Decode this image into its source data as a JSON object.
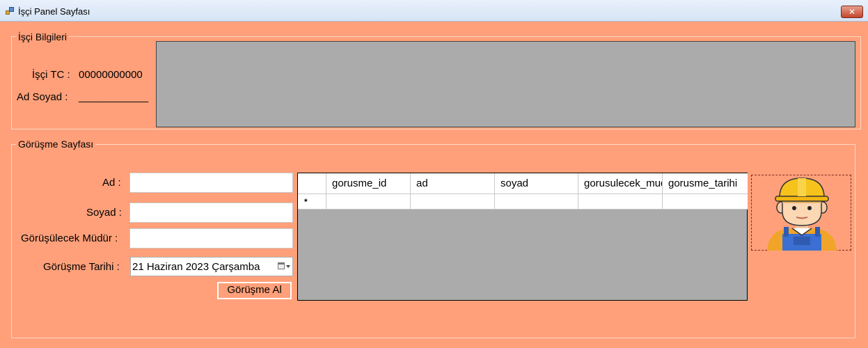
{
  "window": {
    "title": "İşçi Panel Sayfası",
    "close_glyph": "✕"
  },
  "worker_info": {
    "group_label": "İşçi Bilgileri",
    "tc_label": "İşçi TC :",
    "tc_value": "00000000000",
    "name_label": "Ad Soyad :",
    "name_value": "____________"
  },
  "meeting": {
    "group_label": "Görüşme Sayfası",
    "ad_label": "Ad :",
    "soyad_label": "Soyad :",
    "mudur_label": "Görüşülecek Müdür :",
    "tarih_label": "Görüşme Tarihi :",
    "ad_value": "",
    "soyad_value": "",
    "mudur_value": "",
    "date_value": "21  Haziran  2023 Çarşamba",
    "submit_label": "Görüşme Al"
  },
  "grid": {
    "columns": [
      "gorusme_id",
      "ad",
      "soyad",
      "gorusulecek_mudur",
      "gorusme_tarihi"
    ],
    "new_row_marker": "*",
    "rows": []
  },
  "picture": {
    "icon": "construction-worker-icon"
  },
  "colors": {
    "background": "#ffa07a",
    "grid_background": "#ababab"
  }
}
